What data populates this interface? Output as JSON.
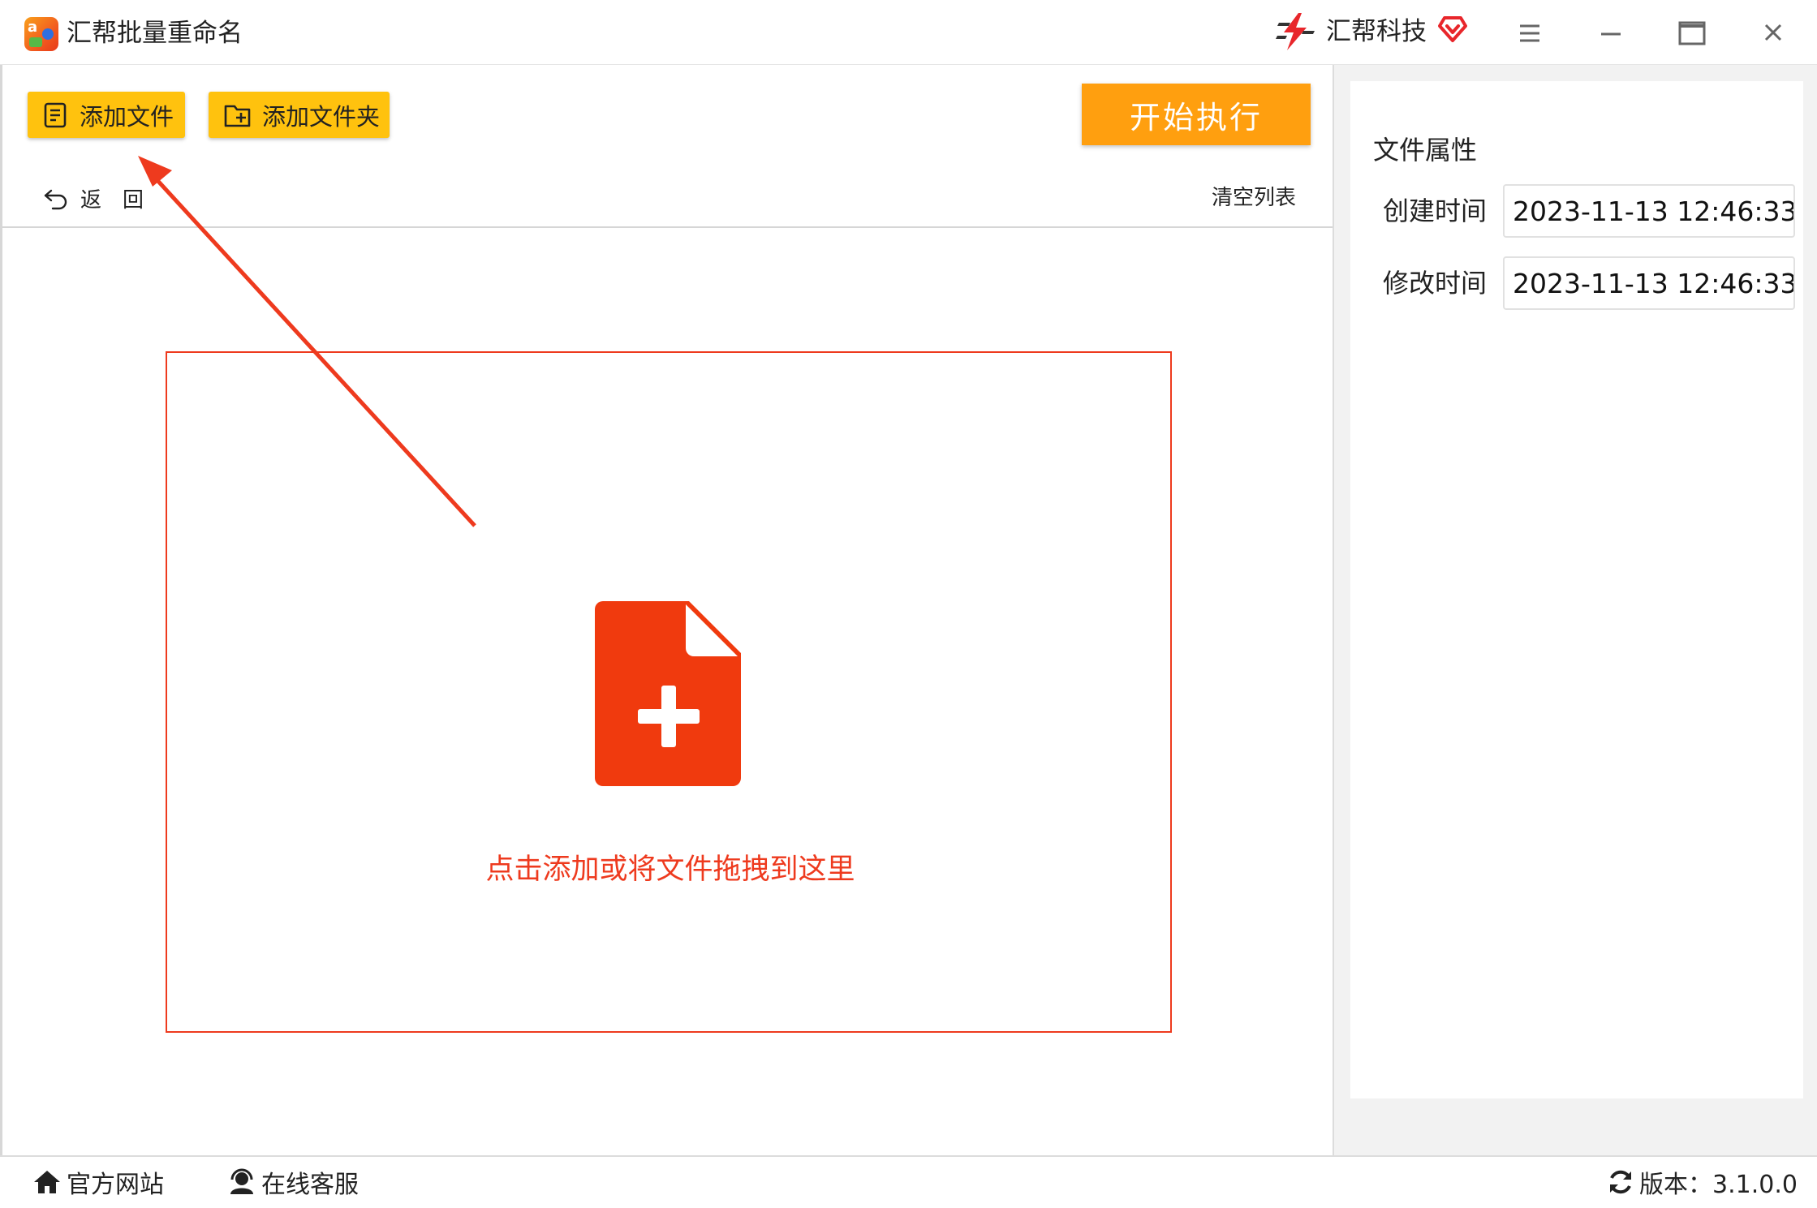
{
  "window": {
    "title": "汇帮批量重命名",
    "brand": "汇帮科技"
  },
  "toolbar": {
    "add_file": "添加文件",
    "add_folder": "添加文件夹",
    "start": "开始执行",
    "back": "返回",
    "clear_list": "清空列表"
  },
  "dropzone": {
    "hint": "点击添加或将文件拖拽到这里"
  },
  "file_properties": {
    "title": "文件属性",
    "created_label": "创建时间",
    "created_value": "2023-11-13 12:46:33",
    "modified_label": "修改时间",
    "modified_value": "2023-11-13 12:46:33"
  },
  "statusbar": {
    "website": "官方网站",
    "support": "在线客服",
    "version": "版本：3.1.0.0"
  },
  "colors": {
    "accent_yellow": "#ffc20e",
    "start_orange": "#ff9f0f",
    "drop_red": "#ee3a1e",
    "icon_red": "#f03a0e"
  },
  "icons": {
    "app": "app-logo-icon",
    "brand": "lightning-h-icon",
    "vip": "vip-heart-icon",
    "menu": "hamburger-menu-icon",
    "minimize": "minimize-icon",
    "maximize": "maximize-icon",
    "close": "close-icon",
    "add_file": "file-list-icon",
    "add_folder": "folder-plus-icon",
    "back": "undo-arrow-icon",
    "drop": "file-plus-icon",
    "website": "home-icon",
    "support": "headset-user-icon",
    "version": "refresh-icon"
  }
}
